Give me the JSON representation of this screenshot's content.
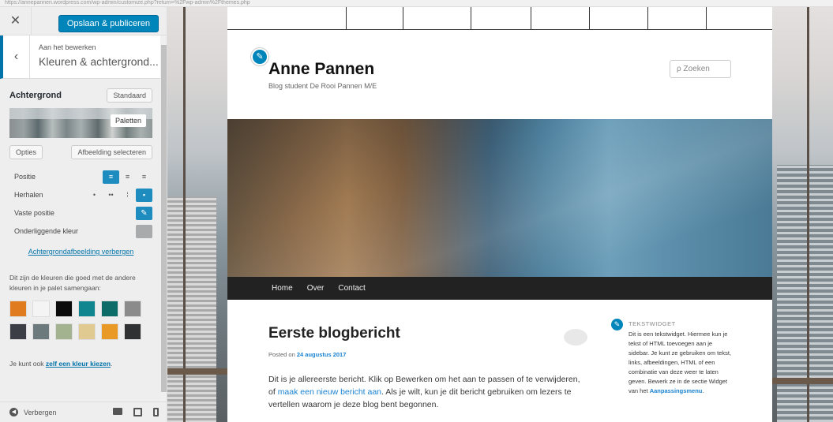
{
  "browser": {
    "url_text": "https://annepannen.wordpress.com/wp-admin/customize.php?return=%2Fwp-admin%2Fthemes.php"
  },
  "sidebar": {
    "close_label": "✕",
    "publish_label": "Opslaan & publiceren",
    "editing_label": "Aan het bewerken",
    "section_title": "Kleuren & achtergrond...",
    "background_title": "Achtergrond",
    "default_label": "Standaard",
    "palettes_tooltip": "Paletten",
    "options_label": "Opties",
    "select_image_label": "Afbeelding selecteren",
    "position_label": "Positie",
    "repeat_label": "Herhalen",
    "fixed_label": "Vaste positie",
    "underlying_color_label": "Onderliggende kleur",
    "hide_image_link": "Achtergrondafbeelding verbergen",
    "palette_description": "Dit zijn de kleuren die goed met de andere kleuren in je palet samengaan:",
    "own_color_prefix": "Je kunt ook",
    "own_color_link": "zelf een kleur kiezen",
    "own_color_suffix": ".",
    "hide_label": "Verbergen",
    "swatches": [
      "#e07b1f",
      "#f4f4f4",
      "#0b0b0b",
      "#12868f",
      "#0d6b68",
      "#8b8b8b",
      "#3b3f45",
      "#6c7a7e",
      "#a4b38f",
      "#e1c992",
      "#e99a26",
      "#2f3133"
    ],
    "accent_color": "#0073aa"
  },
  "site": {
    "title": "Anne Pannen",
    "description": "Blog student De Rooi Pannen M/E",
    "search_placeholder": "ρ Zoeken",
    "nav": [
      "Home",
      "Over",
      "Contact"
    ]
  },
  "post": {
    "title": "Eerste blogbericht",
    "posted_prefix": "Posted on ",
    "posted_date": "24 augustus 2017",
    "body_1": "Dit is je allereerste bericht. Klik op Bewerken om het aan te passen of te verwijderen, of ",
    "body_link": "maak een nieuw bericht aan",
    "body_2": ". Als je wilt, kun je dit bericht gebruiken om lezers te vertellen waarom je deze blog bent begonnen."
  },
  "widget": {
    "title": "TEKSTWIDGET",
    "text": "Dit is een tekstwidget. Hiermee kun je tekst of HTML toevoegen aan je sidebar. Je kunt ze gebruiken om tekst, links, afbeeldingen, HTML of een combinatie van deze weer te laten geven. Bewerk ze in de sectie Widget van het ",
    "link": "Aanpassingsmenu",
    "after": "."
  }
}
